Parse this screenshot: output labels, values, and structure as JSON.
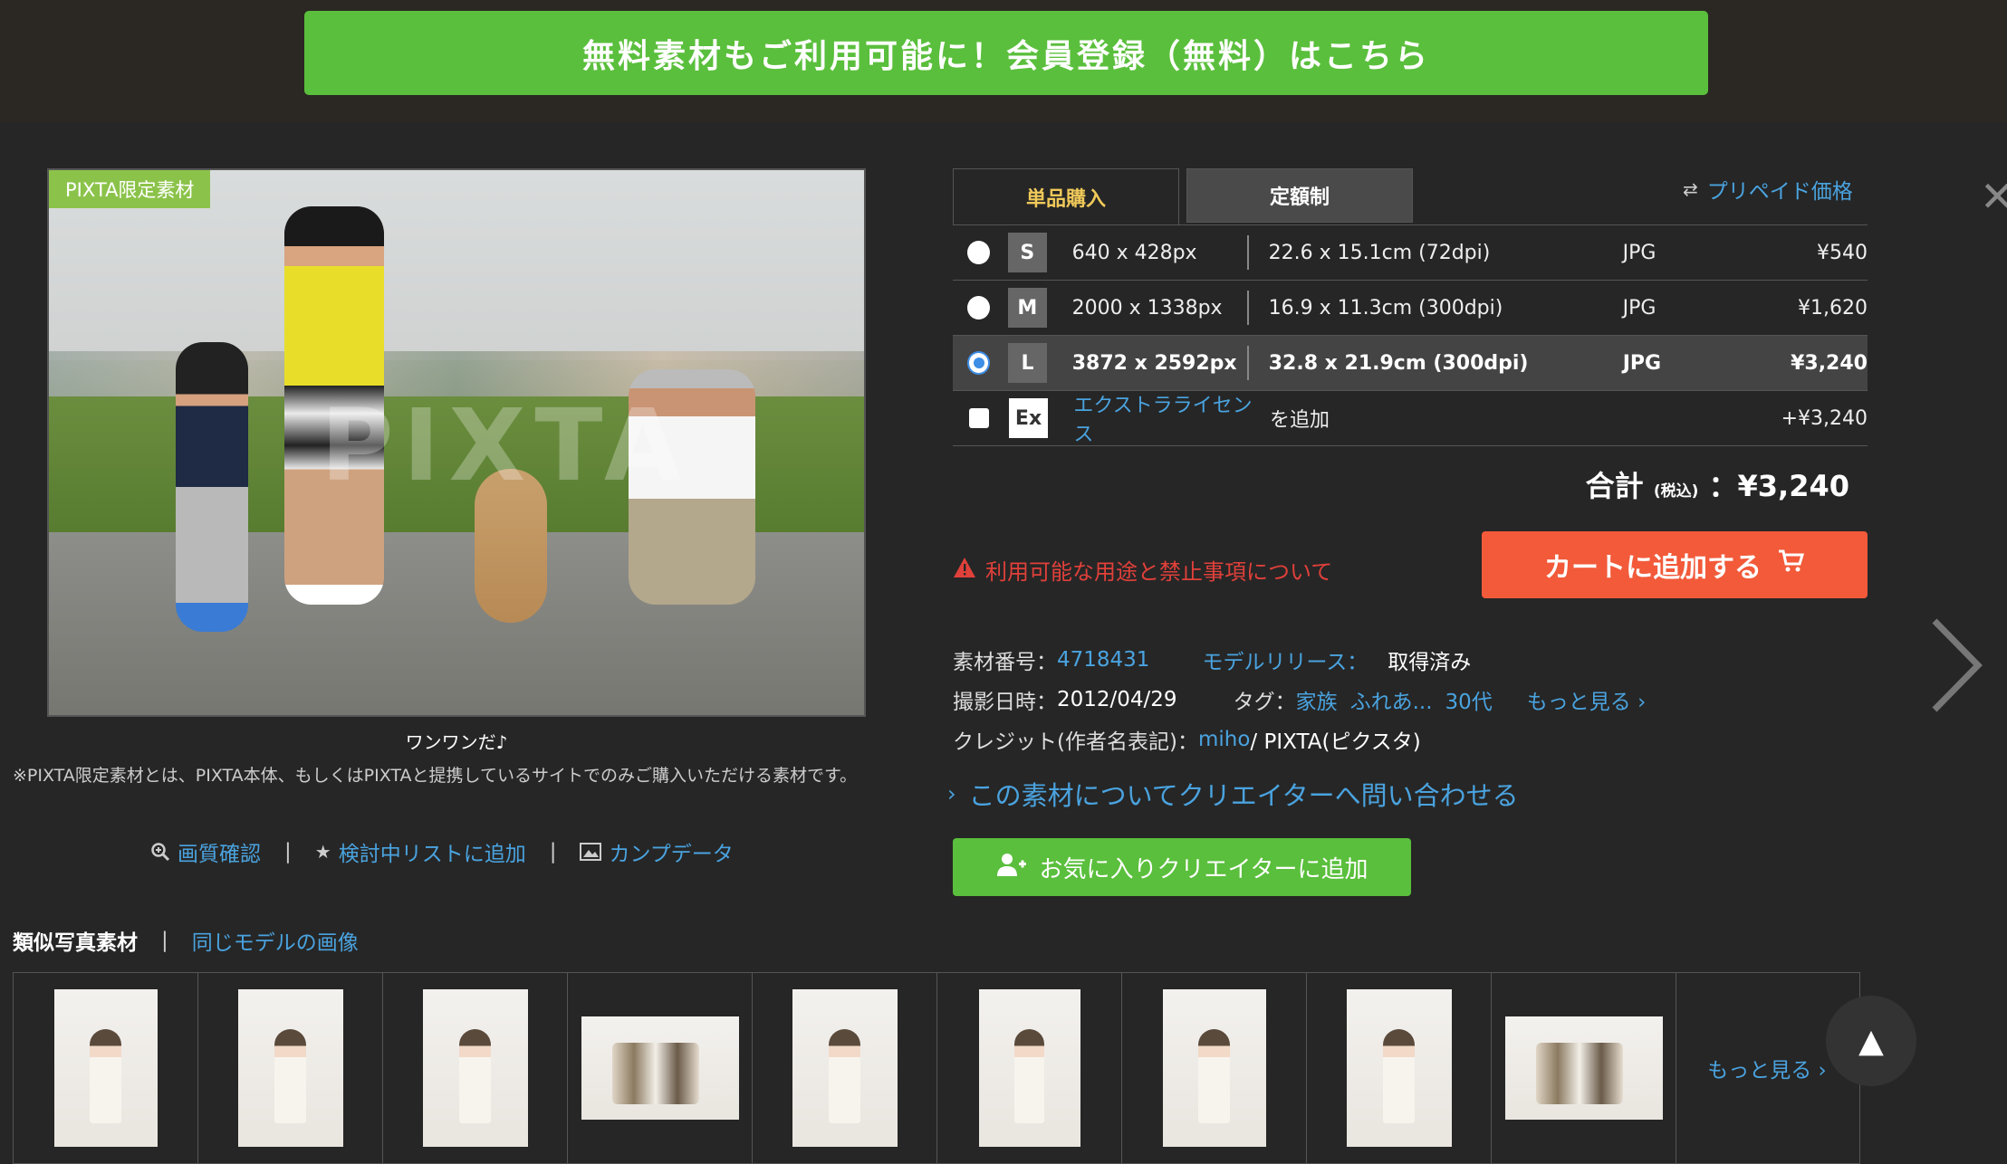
{
  "banner": {
    "text": "無料素材もご利用可能に！会員登録（無料）はこちら"
  },
  "photo": {
    "badge": "PIXTA限定素材",
    "caption": "ワンワンだ♪",
    "note": "※PIXTA限定素材とは、PIXTA本体、もしくはPIXTAと提携しているサイトでのみご購入いただける素材です。",
    "links": [
      {
        "icon": "zoom-icon",
        "label": "画質確認"
      },
      {
        "icon": "star-icon",
        "label": "検討中リストに追加"
      },
      {
        "icon": "image-icon",
        "label": "カンプデータ"
      }
    ]
  },
  "purchase": {
    "tabs": [
      "単品購入",
      "定額制"
    ],
    "prepaid_label": "プリペイド価格",
    "sizes": [
      {
        "code": "S",
        "px": "640 x 428px",
        "cm": "22.6 x 15.1cm (72dpi)",
        "format": "JPG",
        "price": "¥540",
        "selected": false
      },
      {
        "code": "M",
        "px": "2000 x 1338px",
        "cm": "16.9 x 11.3cm (300dpi)",
        "format": "JPG",
        "price": "¥1,620",
        "selected": false
      },
      {
        "code": "L",
        "px": "3872 x 2592px",
        "cm": "32.8 x 21.9cm (300dpi)",
        "format": "JPG",
        "price": "¥3,240",
        "selected": true
      }
    ],
    "extra": {
      "code": "Ex",
      "link": "エクストラライセンス",
      "suffix": "を追加",
      "price": "+¥3,240"
    },
    "total_label": "合計",
    "total_tax": "(税込)",
    "total_value": "：¥3,240",
    "warning": "利用可能な用途と禁止事項について",
    "cart_button": "カートに追加する"
  },
  "meta": {
    "number_label": "素材番号：",
    "number": "4718431",
    "release_label": "モデルリリース：",
    "release": "取得済み",
    "date_label": "撮影日時：",
    "date": "2012/04/29",
    "tags_label": "タグ：",
    "tags": [
      "家族",
      "ふれあ...",
      "30代"
    ],
    "more": "もっと見る ›",
    "credit_label": "クレジット(作者名表記)：",
    "credit_author": "miho",
    "credit_site": " / PIXTA(ピクスタ)"
  },
  "contact": "この素材についてクリエイターへ問い合わせる",
  "fav_button": "お気に入りクリエイターに追加",
  "similar": {
    "tab_current": "類似写真素材",
    "tab_alt": "同じモデルの画像",
    "more": "もっと見る ›"
  },
  "colors": {
    "accent_green": "#5abf3c",
    "cart_orange": "#f25a3a",
    "link_blue": "#4aa3df",
    "warning_red": "#e0403a"
  }
}
